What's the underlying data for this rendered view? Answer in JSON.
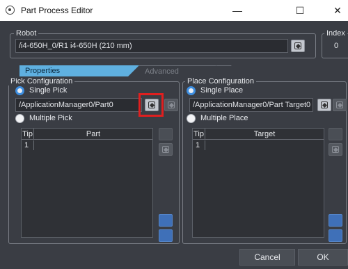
{
  "window": {
    "title": "Part Process Editor",
    "minimize": "—",
    "maximize": "☐",
    "close": "✕"
  },
  "robot": {
    "label": "Robot",
    "path": "/i4-650H_0/R1 i4-650H (210 mm)"
  },
  "index": {
    "label": "Index",
    "value": "0"
  },
  "tabs": [
    {
      "label": "Properties"
    },
    {
      "label": "Advanced"
    }
  ],
  "pick": {
    "group_label": "Pick Configuration",
    "single_label": "Single Pick",
    "path": "/ApplicationManager0/Part0",
    "multiple_label": "Multiple Pick",
    "table": {
      "col_tip": "Tip",
      "col_item": "Part",
      "rows": [
        {
          "tip": "1",
          "item": ""
        }
      ]
    }
  },
  "place": {
    "group_label": "Place Configuration",
    "single_label": "Single Place",
    "path": "/ApplicationManager0/Part Target0",
    "multiple_label": "Multiple Place",
    "table": {
      "col_tip": "Tip",
      "col_item": "Target",
      "rows": [
        {
          "tip": "1",
          "item": ""
        }
      ]
    }
  },
  "footer": {
    "cancel": "Cancel",
    "ok": "OK"
  },
  "colors": {
    "background": "#3a3d44",
    "tab_active": "#5fb0e0",
    "highlight": "#e01f1f"
  }
}
